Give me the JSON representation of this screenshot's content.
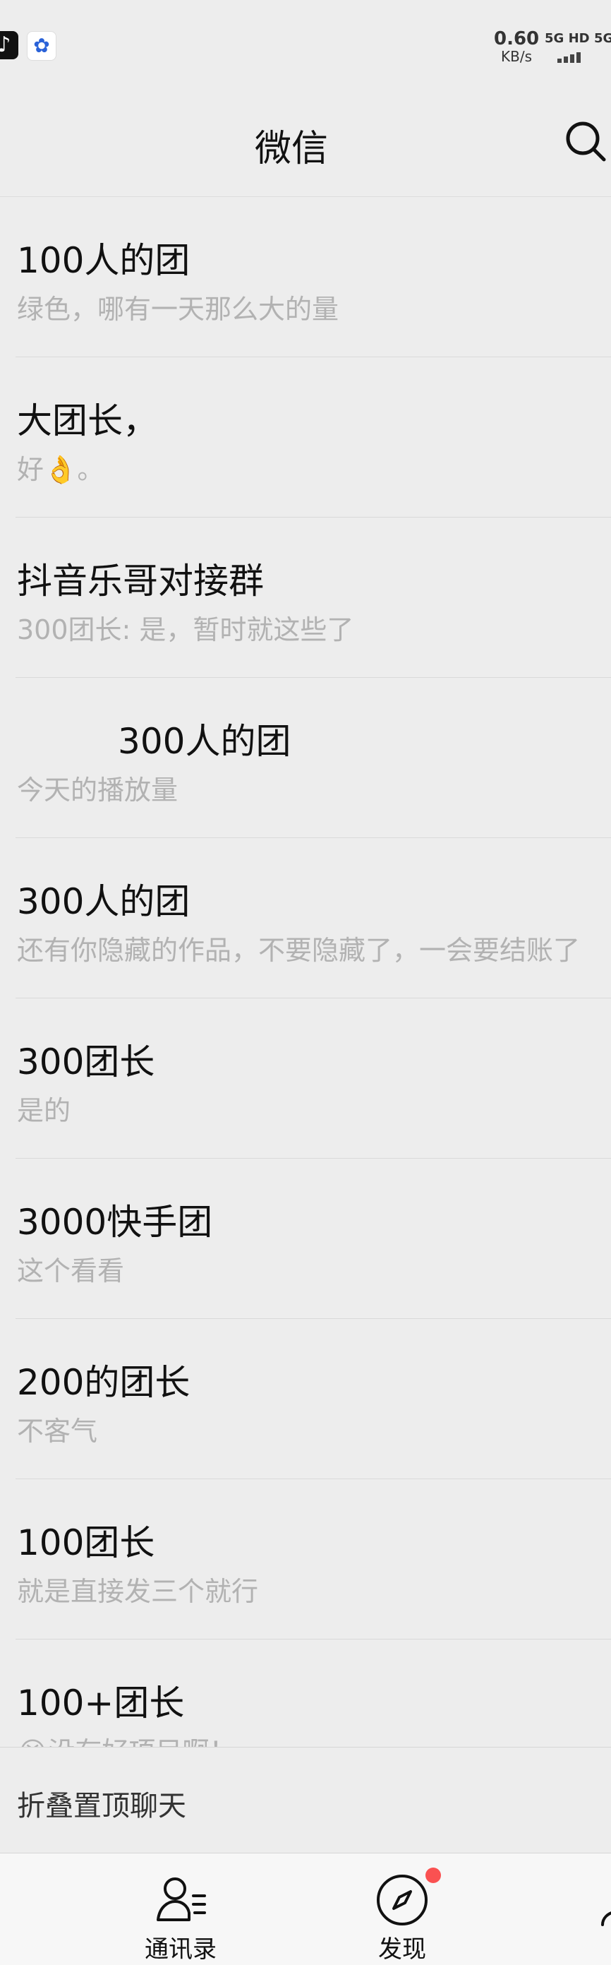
{
  "status_bar": {
    "net_speed_value": "0.60",
    "net_speed_unit": "KB/s",
    "signal_1": "5G HD",
    "signal_2": "5G"
  },
  "header": {
    "title": "微信"
  },
  "chats": [
    {
      "name": "100人的团",
      "preview": "绿色，哪有一天那么大的量"
    },
    {
      "name": "大团长，",
      "preview": "好👌。"
    },
    {
      "name": "抖音乐哥对接群",
      "preview": "300团长: 是，暂时就这些了"
    },
    {
      "name": "         300人的团",
      "preview": "今天的播放量"
    },
    {
      "name": "300人的团",
      "preview": "还有你隐藏的作品，不要隐藏了，一会要结账了"
    },
    {
      "name": "300团长",
      "preview": "是的"
    },
    {
      "name": "3000快手团",
      "preview": "这个看看"
    },
    {
      "name": "200的团长",
      "preview": "不客气"
    },
    {
      "name": "100团长",
      "preview": "就是直接发三个就行"
    },
    {
      "name": "100+团长",
      "preview": "😭没有好项目啊！"
    }
  ],
  "fold_bar": {
    "label": "折叠置顶聊天"
  },
  "tabs": {
    "contacts": {
      "label": "通讯录",
      "icon": "contacts-icon"
    },
    "discover": {
      "label": "发现",
      "icon": "compass-icon",
      "badge": true
    }
  },
  "colors": {
    "background": "#ededed",
    "badge": "#fa5151",
    "preview_text": "#b2b2b2"
  }
}
